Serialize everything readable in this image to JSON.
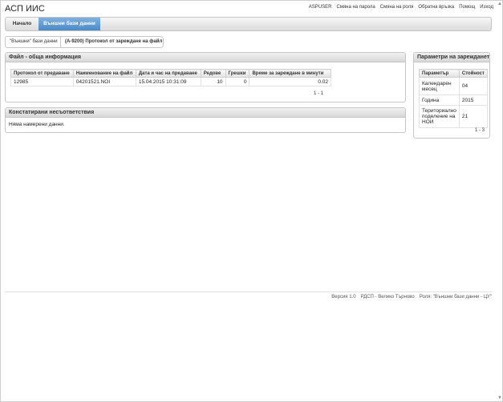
{
  "app": {
    "title": "АСП ИИС"
  },
  "top_links": [
    "ASPUSER",
    "Смяна на парола",
    "Смяна на роля",
    "Обратна връзка",
    "Помощ",
    "Изход"
  ],
  "nav": {
    "tabs": [
      {
        "label": "Начало"
      },
      {
        "label": "Външни бази данни"
      }
    ]
  },
  "breadcrumb": {
    "first": "\"Външни\" бази данни",
    "current": "(А-9200) Протокол от зареждане на файл"
  },
  "file_panel": {
    "title": "Файл - обща информация",
    "headers": [
      "Протокол от предаване",
      "Наименование на файл",
      "Дата и час на предаване",
      "Редове",
      "Грешки",
      "Време за зареждане в минути"
    ],
    "rows": [
      [
        "12985",
        "04201521.NOI",
        "15.04.2015 10:31:09",
        "10",
        "0",
        "0.02"
      ]
    ],
    "pager": "1 - 1"
  },
  "issues_panel": {
    "title": "Констатирани несъответствия",
    "empty": "Няма намерени данни."
  },
  "params_panel": {
    "title": "Параметри на зареждането",
    "headers": [
      "Параметър",
      "Стойност"
    ],
    "rows": [
      [
        "Календарен месец",
        "04"
      ],
      [
        "Година",
        "2015"
      ],
      [
        "Териториално поделение на НОИ",
        "21"
      ]
    ],
    "pager": "1 - 3"
  },
  "footer": {
    "version": "Версия 1.0",
    "office": "РДСП - Велико Търново",
    "role": "Роля: \"Външни бази данни - ЦУ\""
  }
}
